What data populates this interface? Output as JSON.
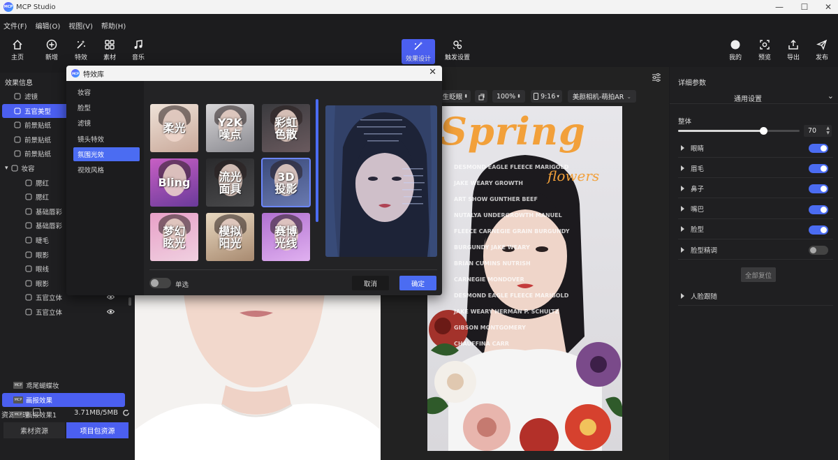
{
  "app": {
    "title": "MCP Studio",
    "logo_text": "MCP"
  },
  "window_controls": [
    "—",
    "☐",
    "✕"
  ],
  "menu": [
    "文件(F)",
    "编辑(O)",
    "视图(V)",
    "帮助(H)"
  ],
  "toolbar_left": [
    {
      "label": "主页",
      "icon": "home-icon"
    },
    {
      "label": "新增",
      "icon": "plus-circle-icon"
    },
    {
      "label": "特效",
      "icon": "magic-wand-icon"
    },
    {
      "label": "素材",
      "icon": "grid-icon"
    },
    {
      "label": "音乐",
      "icon": "music-note-icon"
    }
  ],
  "toolbar_center": [
    {
      "label": "效果设计",
      "icon": "magic-design-icon",
      "active": true
    },
    {
      "label": "触发设置",
      "icon": "trigger-icon",
      "active": false
    }
  ],
  "toolbar_right": [
    {
      "label": "我的",
      "icon": "avatar-icon"
    },
    {
      "label": "预览",
      "icon": "preview-icon"
    },
    {
      "label": "导出",
      "icon": "export-icon"
    },
    {
      "label": "发布",
      "icon": "send-icon"
    }
  ],
  "left_panel": {
    "title": "效果信息",
    "items": [
      {
        "label": "滤镜",
        "level": 1,
        "icon": "filter-icon"
      },
      {
        "label": "五官美型",
        "level": 1,
        "icon": "face-shape-icon",
        "selected": true
      },
      {
        "label": "前景贴纸",
        "level": 1,
        "icon": "sticker-icon"
      },
      {
        "label": "前景贴纸",
        "level": 1,
        "icon": "sticker-icon"
      },
      {
        "label": "前景贴纸",
        "level": 1,
        "icon": "sticker-icon"
      },
      {
        "label": "妆容",
        "level": 0,
        "icon": "makeup-icon",
        "expanded": true
      },
      {
        "label": "腮红",
        "level": 2,
        "icon": "brush-icon"
      },
      {
        "label": "腮红",
        "level": 2,
        "icon": "brush-icon"
      },
      {
        "label": "基础唇彩",
        "level": 2,
        "icon": "brush-icon"
      },
      {
        "label": "基础唇彩",
        "level": 2,
        "icon": "brush-icon"
      },
      {
        "label": "睫毛",
        "level": 2,
        "icon": "brush-icon"
      },
      {
        "label": "眼影",
        "level": 2,
        "icon": "brush-icon"
      },
      {
        "label": "眼线",
        "level": 2,
        "icon": "brush-icon"
      },
      {
        "label": "眼影",
        "level": 2,
        "icon": "brush-icon"
      },
      {
        "label": "五官立体",
        "level": 2,
        "icon": "brush-icon",
        "eye": true
      },
      {
        "label": "五官立体",
        "level": 2,
        "icon": "brush-icon",
        "eye": true
      }
    ]
  },
  "resources": {
    "title": "资源管理",
    "usage": "3.71MB/5MB",
    "tabs": [
      {
        "label": "素材资源",
        "active": false
      },
      {
        "label": "项目包资源",
        "active": true
      }
    ],
    "items": [
      {
        "label": "鸢尾蝴蝶妆",
        "selected": false
      },
      {
        "label": "画报效果",
        "selected": true
      },
      {
        "label": "画报效果1",
        "selected": false
      }
    ],
    "item_badge": "MCP"
  },
  "canvas_controls": {
    "mode": "生眨眼",
    "zoom": "100%",
    "ratio": "9:16",
    "camera": "美颜相机-萌拍AR"
  },
  "poster": {
    "title": "Spring",
    "subtitle": "flowers",
    "lines": [
      "DESMOND EAGLE    FLEECE MARIGOLD",
      "JAKE WEARY    GROWTH",
      "ART SHOW    GUNTHER BEEF",
      "NUTALYA UNDERGROWTH    MANUEL",
      "FLEECE CARNEGIE    GRAIN BURGUNDY",
      "BURGUNDY    JAKE WEARY",
      "BRIAN CUMINS    NUTRISH",
      "CARNEGIE MONDOVER",
      "DESMOND EAGLE    FLEECE MARIGOLD",
      "JAKE WEARY    HERMAN P. SCHULTZ",
      "GIBSON MONTGOMERY",
      "CHAUFFINA CARR"
    ]
  },
  "right_panel": {
    "title": "详细参数",
    "section": "通用设置",
    "overall_label": "整体",
    "overall_value": "70",
    "rows": [
      {
        "label": "眼睛",
        "on": true
      },
      {
        "label": "眉毛",
        "on": true
      },
      {
        "label": "鼻子",
        "on": true
      },
      {
        "label": "嘴巴",
        "on": true
      },
      {
        "label": "脸型",
        "on": true
      },
      {
        "label": "脸型精调",
        "on": false
      }
    ],
    "reset_label": "全部复位",
    "face_track_label": "人脸跟随"
  },
  "dialog": {
    "title": "特效库",
    "categories": [
      {
        "label": "妆容",
        "selected": false
      },
      {
        "label": "脸型",
        "selected": false
      },
      {
        "label": "滤镜",
        "selected": false
      },
      {
        "label": "镜头特效",
        "selected": false
      },
      {
        "label": "氛围光效",
        "selected": true
      },
      {
        "label": "视效风格",
        "selected": false
      }
    ],
    "effects": [
      {
        "label": "柔光",
        "selected": false
      },
      {
        "label": "Y2K\n噪点",
        "selected": false
      },
      {
        "label": "彩虹\n色散",
        "selected": false
      },
      {
        "label": "Bling",
        "selected": false
      },
      {
        "label": "流光\n面具",
        "selected": false
      },
      {
        "label": "3D\n投影",
        "selected": true
      },
      {
        "label": "梦幻\n眩光",
        "selected": false
      },
      {
        "label": "模拟\n阳光",
        "selected": false
      },
      {
        "label": "赛博\n光线",
        "selected": false
      }
    ],
    "single_select_label": "单选",
    "single_select_on": false,
    "cancel_label": "取消",
    "ok_label": "确定"
  },
  "colors": {
    "accent": "#4b5ff0",
    "accent_toggle": "#4b6cf2",
    "bg": "#1c1c1e",
    "panel": "#1f1f21"
  }
}
